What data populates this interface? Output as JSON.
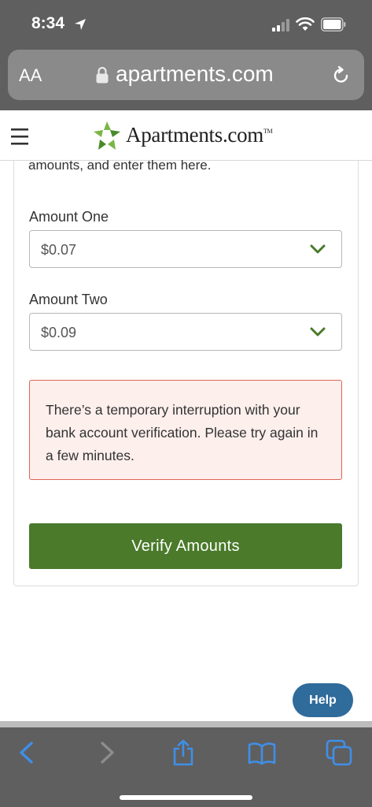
{
  "status_bar": {
    "time": "8:34"
  },
  "browser": {
    "text_size_label": "AA",
    "url": "apartments.com"
  },
  "site": {
    "logo_text": "Apartments.com",
    "logo_tm": "TM"
  },
  "form": {
    "intro_text": "amounts, and enter them here.",
    "amount_one": {
      "label": "Amount One",
      "value": "$0.07"
    },
    "amount_two": {
      "label": "Amount Two",
      "value": "$0.09"
    },
    "error_message": "There’s a temporary interruption with your bank account verification. Please try again in a few minutes.",
    "verify_label": "Verify Amounts"
  },
  "help_label": "Help",
  "colors": {
    "brand_green": "#4a7a2a",
    "error_border": "#e06555",
    "error_bg": "#fcefec",
    "help_blue": "#2f6b9b",
    "toolbar_blue": "#3f8fe8"
  },
  "toolbar": {
    "icons": [
      "back-icon",
      "forward-icon",
      "share-icon",
      "bookmarks-icon",
      "tabs-icon"
    ]
  }
}
